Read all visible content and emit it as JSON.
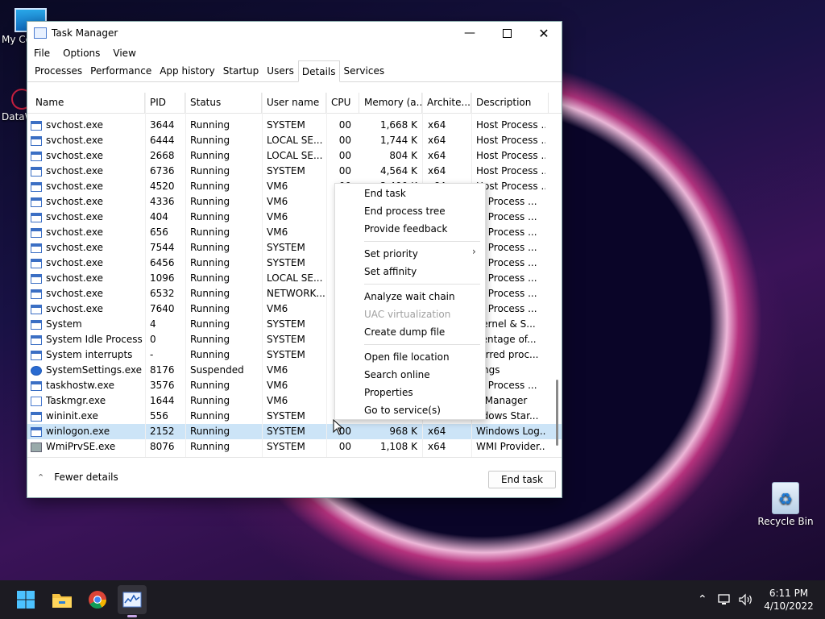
{
  "desktop": {
    "icons": [
      {
        "label": "My Co"
      },
      {
        "label": "DataW"
      },
      {
        "label": "Recycle Bin"
      }
    ]
  },
  "window": {
    "title": "Task Manager",
    "menu": [
      "File",
      "Options",
      "View"
    ],
    "tabs": [
      "Processes",
      "Performance",
      "App history",
      "Startup",
      "Users",
      "Details",
      "Services"
    ],
    "active_tab": "Details",
    "columns": [
      "Name",
      "PID",
      "Status",
      "User name",
      "CPU",
      "Memory (a...",
      "Archite...",
      "Description"
    ],
    "rows": [
      {
        "name": "svchost.exe",
        "pid": "3644",
        "status": "Running",
        "user": "SYSTEM",
        "cpu": "00",
        "mem": "1,668 K",
        "arch": "x64",
        "desc": "Host Process ...",
        "icon": "svc"
      },
      {
        "name": "svchost.exe",
        "pid": "6444",
        "status": "Running",
        "user": "LOCAL SE...",
        "cpu": "00",
        "mem": "1,744 K",
        "arch": "x64",
        "desc": "Host Process ...",
        "icon": "svc"
      },
      {
        "name": "svchost.exe",
        "pid": "2668",
        "status": "Running",
        "user": "LOCAL SE...",
        "cpu": "00",
        "mem": "804 K",
        "arch": "x64",
        "desc": "Host Process ...",
        "icon": "svc"
      },
      {
        "name": "svchost.exe",
        "pid": "6736",
        "status": "Running",
        "user": "SYSTEM",
        "cpu": "00",
        "mem": "4,564 K",
        "arch": "x64",
        "desc": "Host Process ...",
        "icon": "svc"
      },
      {
        "name": "svchost.exe",
        "pid": "4520",
        "status": "Running",
        "user": "VM6",
        "cpu": "",
        "mem": "",
        "arch": "",
        "desc": "Host Process ...",
        "icon": "svc"
      },
      {
        "name": "svchost.exe",
        "pid": "4336",
        "status": "Running",
        "user": "VM6",
        "cpu": "",
        "mem": "",
        "arch": "",
        "desc": "st Process ...",
        "icon": "svc"
      },
      {
        "name": "svchost.exe",
        "pid": "404",
        "status": "Running",
        "user": "VM6",
        "cpu": "",
        "mem": "",
        "arch": "",
        "desc": "st Process ...",
        "icon": "svc"
      },
      {
        "name": "svchost.exe",
        "pid": "656",
        "status": "Running",
        "user": "VM6",
        "cpu": "",
        "mem": "",
        "arch": "",
        "desc": "st Process ...",
        "icon": "svc"
      },
      {
        "name": "svchost.exe",
        "pid": "7544",
        "status": "Running",
        "user": "SYSTEM",
        "cpu": "",
        "mem": "",
        "arch": "",
        "desc": "st Process ...",
        "icon": "svc"
      },
      {
        "name": "svchost.exe",
        "pid": "6456",
        "status": "Running",
        "user": "SYSTEM",
        "cpu": "",
        "mem": "",
        "arch": "",
        "desc": "st Process ...",
        "icon": "svc"
      },
      {
        "name": "svchost.exe",
        "pid": "1096",
        "status": "Running",
        "user": "LOCAL SE...",
        "cpu": "",
        "mem": "",
        "arch": "",
        "desc": "st Process ...",
        "icon": "svc"
      },
      {
        "name": "svchost.exe",
        "pid": "6532",
        "status": "Running",
        "user": "NETWORK...",
        "cpu": "",
        "mem": "",
        "arch": "",
        "desc": "st Process ...",
        "icon": "svc"
      },
      {
        "name": "svchost.exe",
        "pid": "7640",
        "status": "Running",
        "user": "VM6",
        "cpu": "",
        "mem": "",
        "arch": "",
        "desc": "st Process ...",
        "icon": "svc"
      },
      {
        "name": "System",
        "pid": "4",
        "status": "Running",
        "user": "SYSTEM",
        "cpu": "",
        "mem": "",
        "arch": "",
        "desc": "Kernel & S...",
        "icon": "svc"
      },
      {
        "name": "System Idle Process",
        "pid": "0",
        "status": "Running",
        "user": "SYSTEM",
        "cpu": "",
        "mem": "",
        "arch": "",
        "desc": "centage of...",
        "icon": "svc"
      },
      {
        "name": "System interrupts",
        "pid": "-",
        "status": "Running",
        "user": "SYSTEM",
        "cpu": "",
        "mem": "",
        "arch": "",
        "desc": "ferred proc...",
        "icon": "svc"
      },
      {
        "name": "SystemSettings.exe",
        "pid": "8176",
        "status": "Suspended",
        "user": "VM6",
        "cpu": "",
        "mem": "",
        "arch": "",
        "desc": "tings",
        "icon": "gear"
      },
      {
        "name": "taskhostw.exe",
        "pid": "3576",
        "status": "Running",
        "user": "VM6",
        "cpu": "",
        "mem": "",
        "arch": "",
        "desc": "st Process ...",
        "icon": "svc"
      },
      {
        "name": "Taskmgr.exe",
        "pid": "1644",
        "status": "Running",
        "user": "VM6",
        "cpu": "",
        "mem": "",
        "arch": "",
        "desc": "k Manager",
        "icon": "chart"
      },
      {
        "name": "wininit.exe",
        "pid": "556",
        "status": "Running",
        "user": "SYSTEM",
        "cpu": "",
        "mem": "",
        "arch": "",
        "desc": "ndows Star...",
        "icon": "svc"
      },
      {
        "name": "winlogon.exe",
        "pid": "2152",
        "status": "Running",
        "user": "SYSTEM",
        "cpu": "00",
        "mem": "968 K",
        "arch": "x64",
        "desc": "Windows Log...",
        "icon": "svc",
        "selected": true
      },
      {
        "name": "WmiPrvSE.exe",
        "pid": "8076",
        "status": "Running",
        "user": "SYSTEM",
        "cpu": "00",
        "mem": "1,108 K",
        "arch": "x64",
        "desc": "WMI Provider...",
        "icon": "wmi"
      }
    ],
    "row5_partial": {
      "cpu": "00",
      "mem": "2,400 K",
      "arch": "x64"
    },
    "footer": {
      "fewer_details": "Fewer details",
      "end_task": "End task"
    }
  },
  "context_menu": {
    "items": [
      {
        "label": "End task",
        "disabled": false
      },
      {
        "label": "End process tree",
        "disabled": false
      },
      {
        "label": "Provide feedback",
        "disabled": false
      },
      {
        "label": "Set priority",
        "disabled": false,
        "submenu": true
      },
      {
        "label": "Set affinity",
        "disabled": false
      },
      {
        "label": "Analyze wait chain",
        "disabled": false
      },
      {
        "label": "UAC virtualization",
        "disabled": true
      },
      {
        "label": "Create dump file",
        "disabled": false
      },
      {
        "label": "Open file location",
        "disabled": false
      },
      {
        "label": "Search online",
        "disabled": false
      },
      {
        "label": "Properties",
        "disabled": false
      },
      {
        "label": "Go to service(s)",
        "disabled": false
      }
    ]
  },
  "taskbar": {
    "apps": [
      "start-icon",
      "file-explorer-icon",
      "chrome-icon",
      "task-manager-icon"
    ],
    "clock": {
      "time": "6:11 PM",
      "date": "4/10/2022"
    }
  }
}
